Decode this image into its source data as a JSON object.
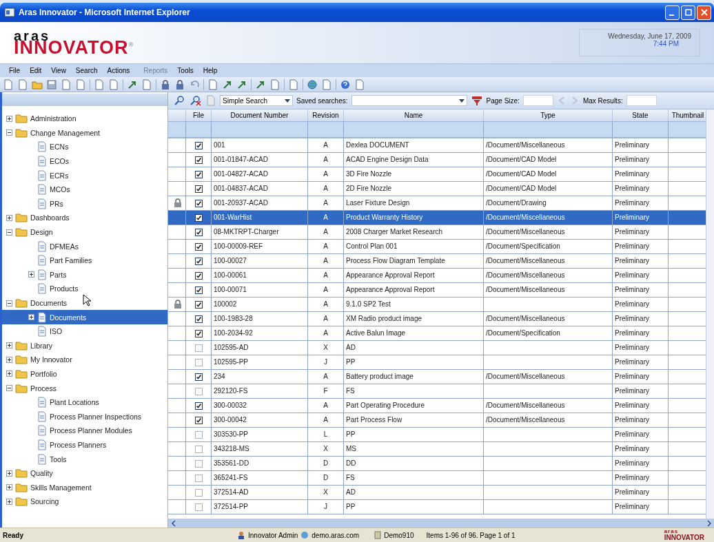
{
  "window": {
    "title": "Aras Innovator - Microsoft Internet Explorer"
  },
  "header": {
    "logo_top": "aras",
    "logo_main": "INNOVATOR",
    "logo_mark": "®",
    "date": "Wednesday, June 17, 2009",
    "time": "7:44 PM"
  },
  "menu": [
    {
      "label": "File",
      "disabled": false
    },
    {
      "label": "Edit",
      "disabled": false
    },
    {
      "label": "View",
      "disabled": false
    },
    {
      "label": "Search",
      "disabled": false
    },
    {
      "label": "Actions",
      "disabled": false
    },
    {
      "label": "Reports",
      "disabled": true
    },
    {
      "label": "Tools",
      "disabled": false
    },
    {
      "label": "Help",
      "disabled": false
    }
  ],
  "tree": [
    {
      "label": "Administration",
      "kind": "folder",
      "expanded": false,
      "selected": false
    },
    {
      "label": "Change Management",
      "kind": "folder",
      "expanded": true,
      "selected": false,
      "children": [
        {
          "label": "ECNs",
          "kind": "item",
          "selected": false
        },
        {
          "label": "ECOs",
          "kind": "item",
          "selected": false
        },
        {
          "label": "ECRs",
          "kind": "item",
          "selected": false
        },
        {
          "label": "MCOs",
          "kind": "item",
          "selected": false
        },
        {
          "label": "PRs",
          "kind": "item",
          "selected": false
        }
      ]
    },
    {
      "label": "Dashboards",
      "kind": "folder",
      "expanded": false,
      "selected": false
    },
    {
      "label": "Design",
      "kind": "folder",
      "expanded": true,
      "selected": false,
      "children": [
        {
          "label": "DFMEAs",
          "kind": "item",
          "selected": false
        },
        {
          "label": "Part Families",
          "kind": "item",
          "selected": false
        },
        {
          "label": "Parts",
          "kind": "item",
          "expanded": false,
          "selected": false
        },
        {
          "label": "Products",
          "kind": "item",
          "selected": false
        }
      ]
    },
    {
      "label": "Documents",
      "kind": "folder",
      "expanded": true,
      "selected": false,
      "children": [
        {
          "label": "Documents",
          "kind": "item",
          "expanded": false,
          "selected": true
        },
        {
          "label": "ISO",
          "kind": "item",
          "selected": false
        }
      ]
    },
    {
      "label": "Library",
      "kind": "folder",
      "expanded": false,
      "selected": false
    },
    {
      "label": "My Innovator",
      "kind": "folder",
      "expanded": false,
      "selected": false
    },
    {
      "label": "Portfolio",
      "kind": "folder",
      "expanded": false,
      "selected": false
    },
    {
      "label": "Process",
      "kind": "folder",
      "expanded": true,
      "selected": false,
      "children": [
        {
          "label": "Plant Locations",
          "kind": "item",
          "selected": false
        },
        {
          "label": "Process Planner Inspections",
          "kind": "item",
          "selected": false
        },
        {
          "label": "Process Planner Modules",
          "kind": "item",
          "selected": false
        },
        {
          "label": "Process Planners",
          "kind": "item",
          "selected": false
        },
        {
          "label": "Tools",
          "kind": "item",
          "selected": false
        }
      ]
    },
    {
      "label": "Quality",
      "kind": "folder",
      "expanded": false,
      "selected": false
    },
    {
      "label": "Skills Management",
      "kind": "folder",
      "expanded": false,
      "selected": false
    },
    {
      "label": "Sourcing",
      "kind": "folder",
      "expanded": false,
      "selected": false
    }
  ],
  "search_bar": {
    "mode": "Simple Search",
    "saved_label": "Saved searches:",
    "page_size_label": "Page Size:",
    "max_results_label": "Max Results:"
  },
  "table": {
    "columns": [
      "File",
      "Document Number",
      "Revision",
      "Name",
      "Type",
      "State",
      "Thumbnail"
    ],
    "rows": [
      {
        "locked": false,
        "file": true,
        "selected": false,
        "number": "001",
        "revision": "A",
        "name": "Dexlea DOCUMENT",
        "type": "/Document/Miscellaneous",
        "state": "Preliminary"
      },
      {
        "locked": false,
        "file": true,
        "selected": false,
        "number": "001-01847-ACAD",
        "revision": "A",
        "name": "ACAD Engine Design Data",
        "type": "/Document/CAD Model",
        "state": "Preliminary"
      },
      {
        "locked": false,
        "file": true,
        "selected": false,
        "number": "001-04827-ACAD",
        "revision": "A",
        "name": "3D Fire Nozzle",
        "type": "/Document/CAD Model",
        "state": "Preliminary"
      },
      {
        "locked": false,
        "file": true,
        "selected": false,
        "number": "001-04837-ACAD",
        "revision": "A",
        "name": "2D Fire Nozzle",
        "type": "/Document/CAD Model",
        "state": "Preliminary"
      },
      {
        "locked": true,
        "file": true,
        "selected": false,
        "number": "001-20937-ACAD",
        "revision": "A",
        "name": "Laser Fixture Design",
        "type": "/Document/Drawing",
        "state": "Preliminary"
      },
      {
        "locked": false,
        "file": true,
        "selected": true,
        "number": "001-WarHist",
        "revision": "A",
        "name": "Product Warranty History",
        "type": "/Document/Miscellaneous",
        "state": "Preliminary"
      },
      {
        "locked": false,
        "file": true,
        "selected": false,
        "number": "08-MKTRPT-Charger",
        "revision": "A",
        "name": "2008 Charger Market Research",
        "type": "/Document/Miscellaneous",
        "state": "Preliminary"
      },
      {
        "locked": false,
        "file": true,
        "selected": false,
        "number": "100-00009-REF",
        "revision": "A",
        "name": "Control Plan 001",
        "type": "/Document/Specification",
        "state": "Preliminary"
      },
      {
        "locked": false,
        "file": true,
        "selected": false,
        "number": "100-00027",
        "revision": "A",
        "name": "Process Flow Diagram Template",
        "type": "/Document/Miscellaneous",
        "state": "Preliminary"
      },
      {
        "locked": false,
        "file": true,
        "selected": false,
        "number": "100-00061",
        "revision": "A",
        "name": "Appearance Approval Report",
        "type": "/Document/Miscellaneous",
        "state": "Preliminary"
      },
      {
        "locked": false,
        "file": true,
        "selected": false,
        "number": "100-00071",
        "revision": "A",
        "name": "Appearance Approval Report",
        "type": "/Document/Miscellaneous",
        "state": "Preliminary"
      },
      {
        "locked": true,
        "file": true,
        "selected": false,
        "number": "100002",
        "revision": "A",
        "name": "9.1.0 SP2 Test",
        "type": "",
        "state": "Preliminary"
      },
      {
        "locked": false,
        "file": true,
        "selected": false,
        "number": "100-1983-28",
        "revision": "A",
        "name": "XM Radio product image",
        "type": "/Document/Miscellaneous",
        "state": "Preliminary"
      },
      {
        "locked": false,
        "file": true,
        "selected": false,
        "number": "100-2034-92",
        "revision": "A",
        "name": "Active Balun Image",
        "type": "/Document/Specification",
        "state": "Preliminary"
      },
      {
        "locked": false,
        "file": false,
        "selected": false,
        "number": "102595-AD",
        "revision": "X",
        "name": "AD",
        "type": "",
        "state": "Preliminary"
      },
      {
        "locked": false,
        "file": false,
        "selected": false,
        "number": "102595-PP",
        "revision": "J",
        "name": "PP",
        "type": "",
        "state": "Preliminary"
      },
      {
        "locked": false,
        "file": true,
        "selected": false,
        "number": "234",
        "revision": "A",
        "name": "Battery product image",
        "type": "/Document/Miscellaneous",
        "state": "Preliminary"
      },
      {
        "locked": false,
        "file": false,
        "selected": false,
        "number": "292120-FS",
        "revision": "F",
        "name": "FS",
        "type": "",
        "state": "Preliminary"
      },
      {
        "locked": false,
        "file": true,
        "selected": false,
        "number": "300-00032",
        "revision": "A",
        "name": "Part Operating Procedure",
        "type": "/Document/Miscellaneous",
        "state": "Preliminary"
      },
      {
        "locked": false,
        "file": true,
        "selected": false,
        "number": "300-00042",
        "revision": "A",
        "name": "Part Process Flow",
        "type": "/Document/Miscellaneous",
        "state": "Preliminary"
      },
      {
        "locked": false,
        "file": false,
        "selected": false,
        "number": "303530-PP",
        "revision": "L",
        "name": "PP",
        "type": "",
        "state": "Preliminary"
      },
      {
        "locked": false,
        "file": false,
        "selected": false,
        "number": "343218-MS",
        "revision": "X",
        "name": "MS",
        "type": "",
        "state": "Preliminary"
      },
      {
        "locked": false,
        "file": false,
        "selected": false,
        "number": "353561-DD",
        "revision": "D",
        "name": "DD",
        "type": "",
        "state": "Preliminary"
      },
      {
        "locked": false,
        "file": false,
        "selected": false,
        "number": "365241-FS",
        "revision": "D",
        "name": "FS",
        "type": "",
        "state": "Preliminary"
      },
      {
        "locked": false,
        "file": false,
        "selected": false,
        "number": "372514-AD",
        "revision": "X",
        "name": "AD",
        "type": "",
        "state": "Preliminary"
      },
      {
        "locked": false,
        "file": false,
        "selected": false,
        "number": "372514-PP",
        "revision": "J",
        "name": "PP",
        "type": "",
        "state": "Preliminary"
      }
    ]
  },
  "status_bar": {
    "status": "Ready",
    "user": "Innovator Admin",
    "server": "demo.aras.com",
    "database": "Demo910",
    "items": "Items 1-96 of 96. Page 1 of 1",
    "logo_top": "aras",
    "logo_main": "INNOVATOR"
  }
}
